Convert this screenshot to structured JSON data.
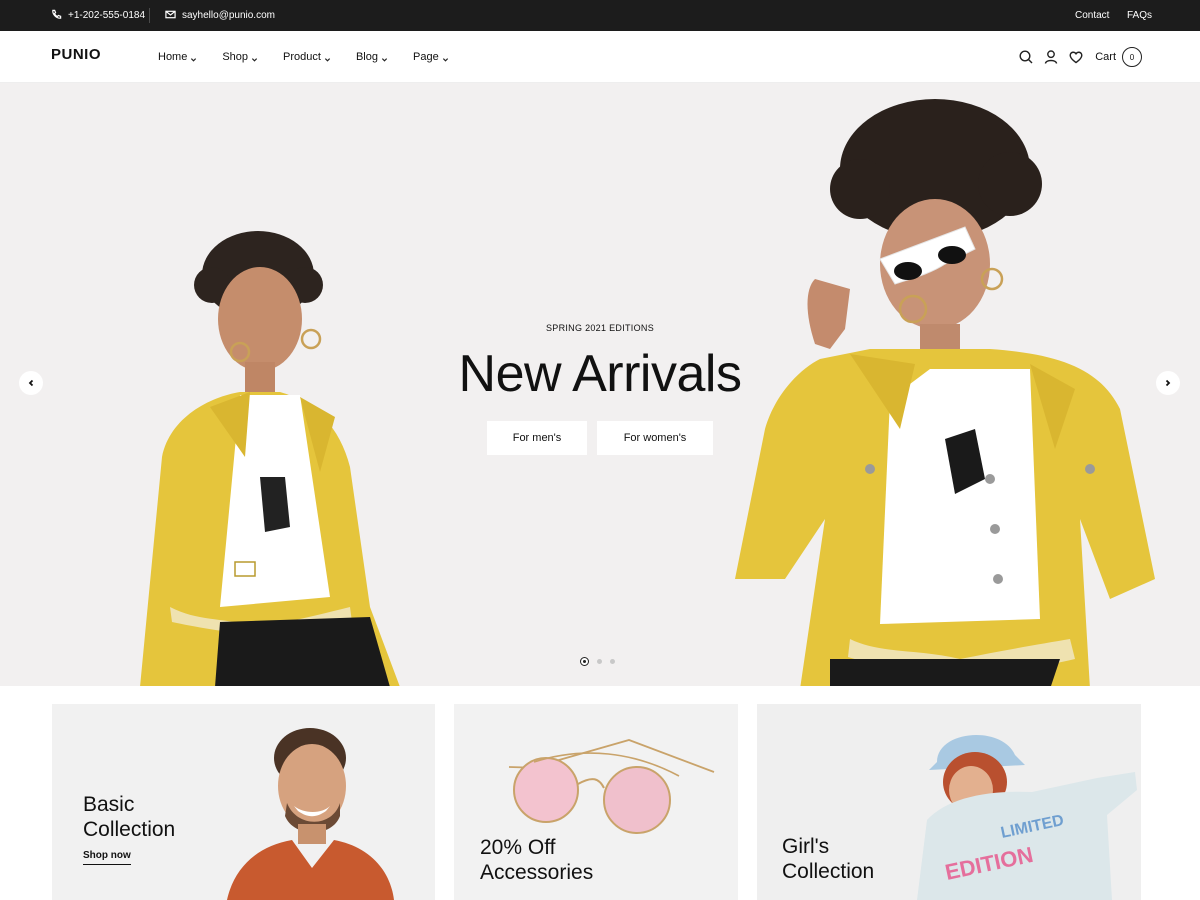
{
  "topbar": {
    "phone": "+1-202-555-0184",
    "email": "sayhello@punio.com",
    "links": [
      "Contact",
      "FAQs"
    ]
  },
  "header": {
    "logo": "PUNIO",
    "nav": [
      "Home",
      "Shop",
      "Product",
      "Blog",
      "Page"
    ],
    "cart_label": "Cart",
    "cart_count": "0",
    "icons": [
      "search-icon",
      "user-icon",
      "heart-icon"
    ]
  },
  "hero": {
    "eyebrow": "SPRING 2021 EDITIONS",
    "title": "New Arrivals",
    "btn_men": "For men's",
    "btn_women": "For women's",
    "slide_count": 3,
    "active_slide": 1
  },
  "banners": [
    {
      "title": "Basic\nCollection",
      "cta": "Shop now"
    },
    {
      "title": "20% Off\nAccessories"
    },
    {
      "title": "Girl's\nCollection"
    }
  ],
  "colors": {
    "topbar_bg": "#1c1c1c",
    "hero_bg": "#f2f0f0",
    "jacket_yellow": "#e5c53c"
  }
}
